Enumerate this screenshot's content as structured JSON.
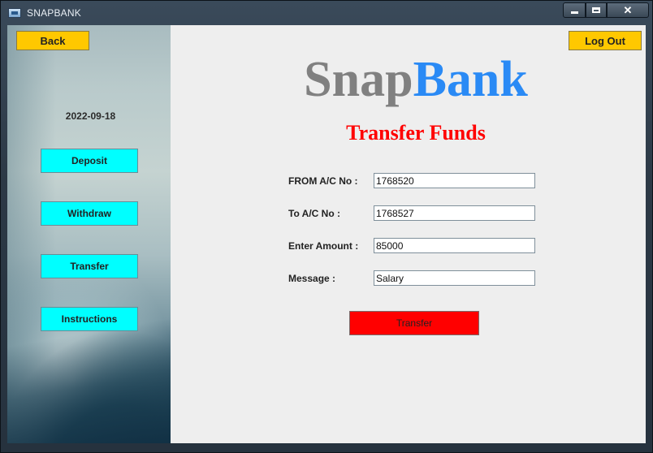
{
  "window": {
    "title": "SNAPBANK",
    "controls": {
      "minimize": "minimize-icon",
      "maximize": "maximize-icon",
      "close": "✕"
    }
  },
  "sidebar": {
    "back_label": "Back",
    "date": "2022-09-18",
    "items": [
      {
        "label": "Deposit"
      },
      {
        "label": "Withdraw"
      },
      {
        "label": "Transfer"
      },
      {
        "label": "Instructions"
      }
    ]
  },
  "header": {
    "logout_label": "Log Out",
    "logo_part1": "Snap",
    "logo_part2": "Bank",
    "page_title": "Transfer Funds"
  },
  "form": {
    "from_label": "FROM A/C No :",
    "from_value": "1768520",
    "to_label": "To A/C No :",
    "to_value": "1768527",
    "amount_label": "Enter Amount :",
    "amount_value": "85000",
    "message_label": "Message :",
    "message_value": "Salary",
    "submit_label": "Transfer"
  },
  "colors": {
    "logo_snap": "#808080",
    "logo_bank": "#2a8af5",
    "heading": "#ff0000",
    "nav_button": "#00ffff",
    "top_button": "#ffc800",
    "submit_button": "#ff0000",
    "content_bg": "#eeeeee"
  }
}
